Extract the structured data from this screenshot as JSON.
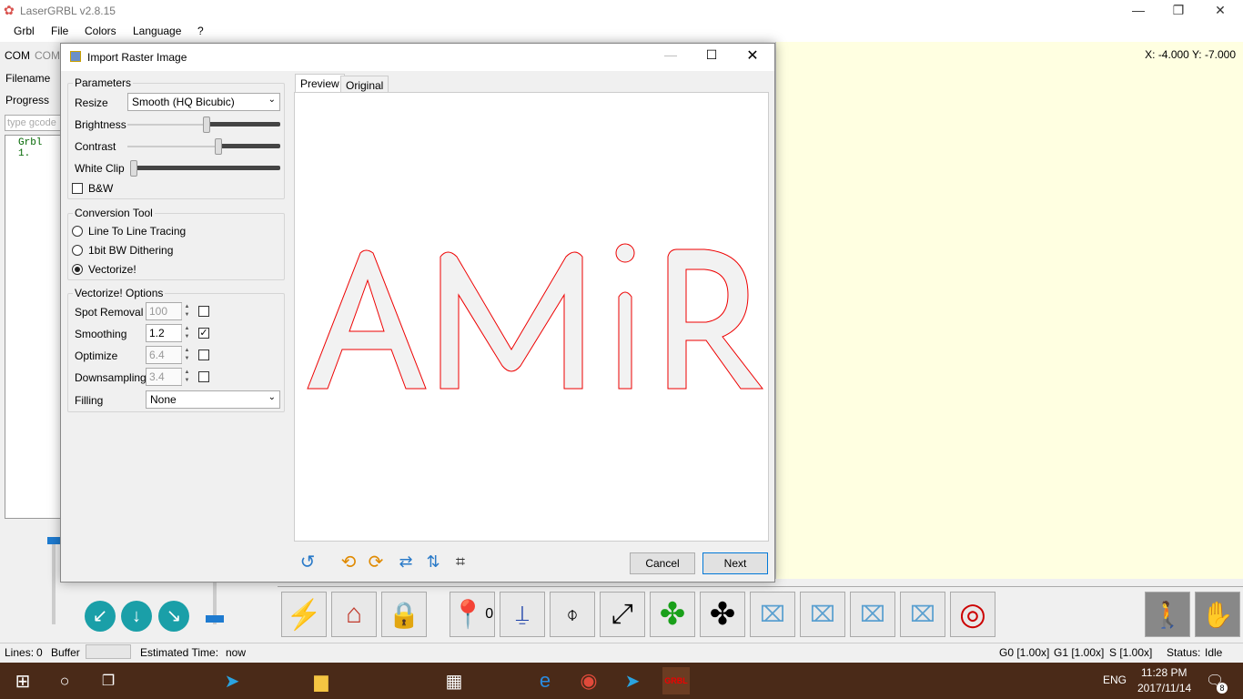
{
  "app": {
    "title": "LaserGRBL v2.8.15"
  },
  "menu": {
    "items": [
      "Grbl",
      "File",
      "Colors",
      "Language",
      "?"
    ]
  },
  "left_panel": {
    "tab_com": "COM",
    "tab_com2": "COM:",
    "filename_label": "Filename",
    "progress_label": "Progress",
    "gcode_placeholder": "type gcode",
    "log_line": "Grbl 1."
  },
  "canvas": {
    "coords": "X: -4.000 Y: -7.000"
  },
  "dialog": {
    "title": "Import Raster Image",
    "parameters": {
      "title": "Parameters",
      "resize_label": "Resize",
      "resize_value": "Smooth (HQ Bicubic)",
      "brightness_label": "Brightness",
      "contrast_label": "Contrast",
      "whiteclip_label": "White Clip",
      "bw_label": "B&W",
      "brightness_level": 0.52,
      "contrast_level": 0.6,
      "whiteclip_level": 0.02
    },
    "conversion": {
      "title": "Conversion Tool",
      "options": [
        "Line To Line Tracing",
        "1bit BW Dithering",
        "Vectorize!"
      ],
      "selected": 2
    },
    "vectorize": {
      "title": "Vectorize! Options",
      "spot_label": "Spot Removal",
      "spot_value": "100",
      "smoothing_label": "Smoothing",
      "smoothing_value": "1.2",
      "optimize_label": "Optimize",
      "optimize_value": "6.4",
      "downsampling_label": "Downsampling",
      "downsampling_value": "3.4",
      "filling_label": "Filling",
      "filling_value": "None"
    },
    "tabs": [
      "Preview",
      "Original"
    ],
    "cancel_label": "Cancel",
    "next_label": "Next"
  },
  "statusbar": {
    "lines_label": "Lines:",
    "lines_value": "0",
    "buffer_label": "Buffer",
    "estimated_label": "Estimated Time:",
    "estimated_value": "now",
    "g0": "G0 [1.00x]",
    "g1": "G1 [1.00x]",
    "s": "S [1.00x]",
    "status_label": "Status:",
    "status_value": "Idle"
  },
  "toolbar": {
    "jog_zero_label": "0"
  },
  "taskbar": {
    "time": "11:28 PM",
    "date": "2017/11/14",
    "lang": "ENG",
    "notif_count": "8"
  }
}
